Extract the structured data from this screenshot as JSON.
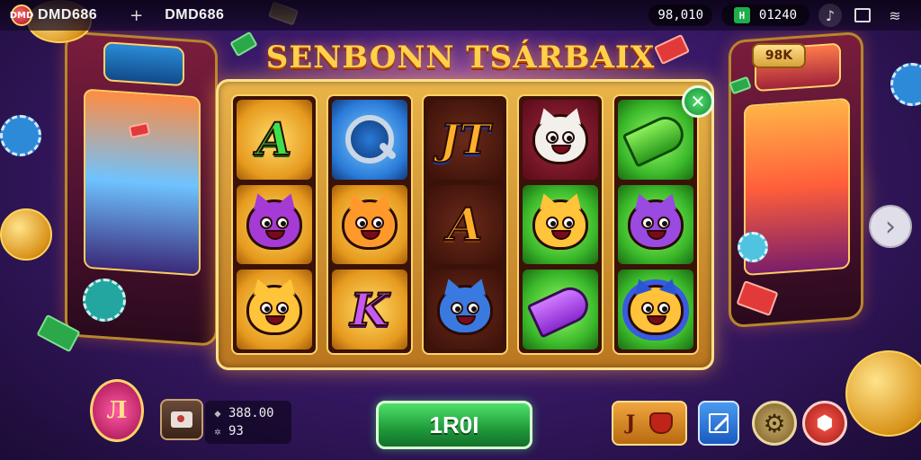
{
  "status_bar": {
    "brand_badge": "DMD",
    "app_name": "DMD686",
    "tab_plus": "+",
    "tab_name": "DMD686",
    "balance": "98,010",
    "secondary_badge": "H",
    "secondary_value": "01240"
  },
  "game": {
    "title": "SENBONN TSÁRBAIX",
    "top_right_button": "98K"
  },
  "reels": [
    [
      {
        "type": "letter",
        "value": "A",
        "color": "green",
        "bg": "gold"
      },
      {
        "type": "critter",
        "icon": "purple-cat-icon",
        "color": "purple",
        "bg": "gold"
      },
      {
        "type": "critter",
        "icon": "orange-cat-icon",
        "color": "yellow",
        "bg": "gold"
      }
    ],
    [
      {
        "type": "icon",
        "icon": "magnifier-icon",
        "bg": "blue"
      },
      {
        "type": "critter",
        "icon": "red-hat-critter-icon",
        "color": "orange",
        "bg": "gold"
      },
      {
        "type": "letter",
        "value": "K",
        "color": "purple",
        "bg": "gold"
      }
    ],
    [
      {
        "type": "letter",
        "value": "JT",
        "color": "jt",
        "bg": "dark"
      },
      {
        "type": "letter",
        "value": "A",
        "color": "orange",
        "bg": "dark"
      },
      {
        "type": "critter",
        "icon": "blue-skull-icon",
        "color": "blue",
        "bg": "dark"
      }
    ],
    [
      {
        "type": "critter",
        "icon": "white-cat-icon",
        "color": "white",
        "bg": "maroon"
      },
      {
        "type": "critter",
        "icon": "lion-icon",
        "color": "yellow",
        "bg": "green"
      },
      {
        "type": "icon",
        "icon": "purple-horn-icon",
        "bg": "green"
      }
    ],
    [
      {
        "type": "icon",
        "icon": "green-horn-icon",
        "bg": "green"
      },
      {
        "type": "critter",
        "icon": "violet-cat-icon",
        "color": "violet",
        "bg": "green"
      },
      {
        "type": "critter",
        "icon": "lion-mane-icon",
        "color": "lion",
        "bg": "green"
      }
    ]
  ],
  "controls": {
    "emblem": "Л",
    "stat_1": "388.00",
    "stat_2": "93",
    "spin_label": "1R0I",
    "combo_label": "J"
  },
  "colors": {
    "title": "#ffd24a",
    "spin": "#2fbf4a",
    "frame": "#e9b44a",
    "background": "#3a1a6a"
  }
}
